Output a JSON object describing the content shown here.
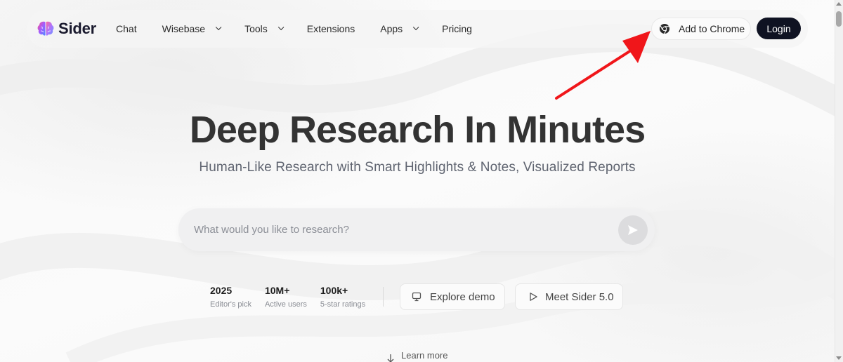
{
  "brand": {
    "name": "Sider"
  },
  "nav": {
    "items": [
      {
        "label": "Chat",
        "has_dropdown": false
      },
      {
        "label": "Wisebase",
        "has_dropdown": true
      },
      {
        "label": "Tools",
        "has_dropdown": true
      },
      {
        "label": "Extensions",
        "has_dropdown": false
      },
      {
        "label": "Apps",
        "has_dropdown": true
      },
      {
        "label": "Pricing",
        "has_dropdown": false
      }
    ],
    "add_to_chrome_label": "Add to Chrome",
    "login_label": "Login"
  },
  "hero": {
    "title": "Deep Research In Minutes",
    "subtitle": "Human-Like Research with Smart Highlights & Notes, Visualized Reports"
  },
  "search": {
    "placeholder": "What would you like to research?",
    "value": ""
  },
  "stats": [
    {
      "value": "2025",
      "label": "Editor's pick"
    },
    {
      "value": "10M+",
      "label": "Active users"
    },
    {
      "value": "100k+",
      "label": "5-star ratings"
    }
  ],
  "actions": {
    "explore_demo": "Explore demo",
    "meet_sider": "Meet Sider 5.0"
  },
  "learn_more": "Learn more",
  "icons": {
    "logo": "brain-icon",
    "chrome": "chrome-icon",
    "send": "send-icon",
    "explore": "monitor-icon",
    "meet": "play-icon",
    "learn_more": "arrow-down-icon",
    "annotation": "red-arrow-icon"
  },
  "colors": {
    "login_bg": "#0f1222",
    "annotation_arrow": "#f0161a",
    "title_text": "#333333"
  }
}
